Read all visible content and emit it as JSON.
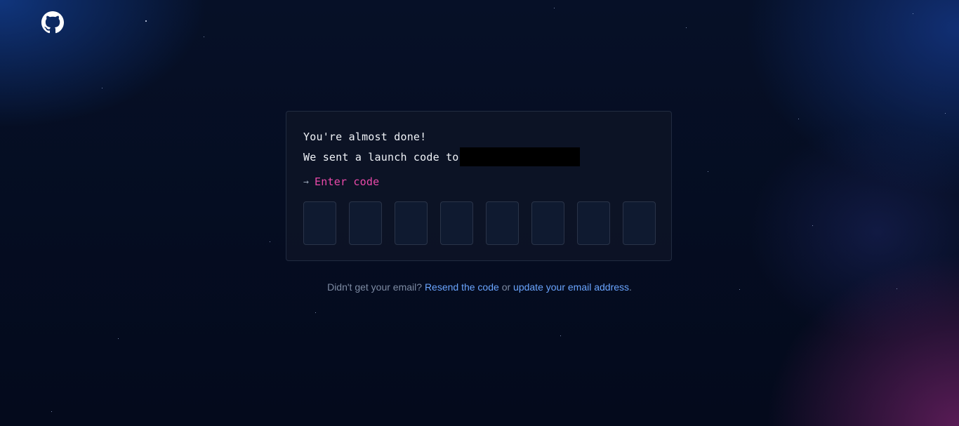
{
  "brand": {
    "logo_icon": "github-octocat-icon"
  },
  "card": {
    "heading": "You're almost done!",
    "sent_text": "We sent a launch code to",
    "prompt_arrow": "→",
    "prompt_label": "Enter code",
    "code_length": 8
  },
  "footer": {
    "question": "Didn't get your email?",
    "resend_link": "Resend the code",
    "or_text": "or",
    "update_link": "update your email address",
    "end": "."
  },
  "colors": {
    "background": "#050b1e",
    "accent_pink": "#ea4aaa",
    "link_blue": "#6aa5ff",
    "muted_text": "#7d8ba3"
  }
}
